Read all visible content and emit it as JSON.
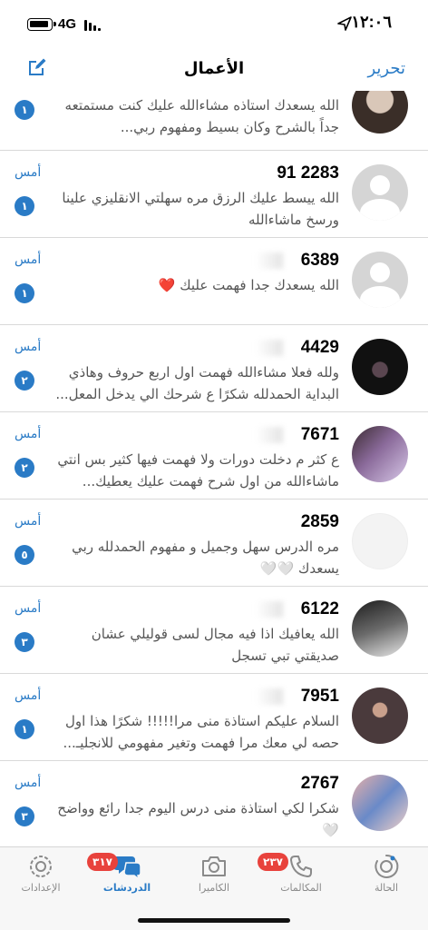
{
  "status_bar": {
    "time": "١٢:٠٦",
    "network": "4G"
  },
  "header": {
    "title": "الأعمال",
    "edit_label": "تحرير"
  },
  "chats": [
    {
      "name": "",
      "message": "الله يسعدك استاذه مشاءالله عليك كنت مستمتعه جداً بالشرح وكان بسيط ومفهوم ربي...",
      "date": "",
      "unread": "١",
      "avatar": "photo-woman"
    },
    {
      "name": "91 2283",
      "message": "الله ييسط عليك الرزق مره سهلتي الانقليزي علينا ورسخ ماشاءالله",
      "date": "أمس",
      "unread": "١",
      "avatar": "placeholder"
    },
    {
      "name": "6389",
      "message": "الله يسعدك جدا فهمت عليك ❤️",
      "date": "أمس",
      "unread": "١",
      "avatar": "placeholder"
    },
    {
      "name": "4429",
      "message": "ولله فعلا مشاءالله فهمت اول اربع حروف وهاذي البداية الحمدلله شكرًا ع شرحك الي يدخل المعل...",
      "date": "أمس",
      "unread": "٢",
      "avatar": "photo-dark"
    },
    {
      "name": "7671",
      "message": "ع كثر م دخلت دورات ولا فهمت فيها كثير بس انتي ماشاءالله من اول شرح فهمت عليك يعطيك...",
      "date": "أمس",
      "unread": "٢",
      "avatar": "photo-purple"
    },
    {
      "name": "2859",
      "message": "مره الدرس سهل وجميل و مفهوم الحمدلله ربي يسعدك 🤍🤍",
      "date": "أمس",
      "unread": "٥",
      "avatar": "photo-light"
    },
    {
      "name": "6122",
      "message": "الله يعافيك اذا فيه مجال لسى قوليلي عشان صديقتي تبي تسجل",
      "date": "أمس",
      "unread": "٣",
      "avatar": "photo-blur"
    },
    {
      "name": "7951",
      "message": "السلام عليكم استاذة منى مرا!!!!! شكرًا هذا اول حصه لي معك مرا فهمت وتغير مفهومي للانجليـ...",
      "date": "أمس",
      "unread": "١",
      "avatar": "photo-hijab"
    },
    {
      "name": "2767",
      "message": "شكرا لكي استاذة منى درس اليوم جدا رائع وواضح 🤍",
      "date": "أمس",
      "unread": "٣",
      "avatar": "photo-art"
    }
  ],
  "tabs": [
    {
      "label": "الإعدادات",
      "icon": "gear-icon"
    },
    {
      "label": "الدردشات",
      "icon": "chat-bubbles-icon",
      "badge": "٣١٧"
    },
    {
      "label": "الكاميرا",
      "icon": "camera-icon"
    },
    {
      "label": "المكالمات",
      "icon": "phone-icon",
      "badge": "٢٣٧"
    },
    {
      "label": "الحالة",
      "icon": "status-icon"
    }
  ],
  "colors": {
    "accent": "#2a7bc6",
    "badge_red": "#e8423c"
  }
}
